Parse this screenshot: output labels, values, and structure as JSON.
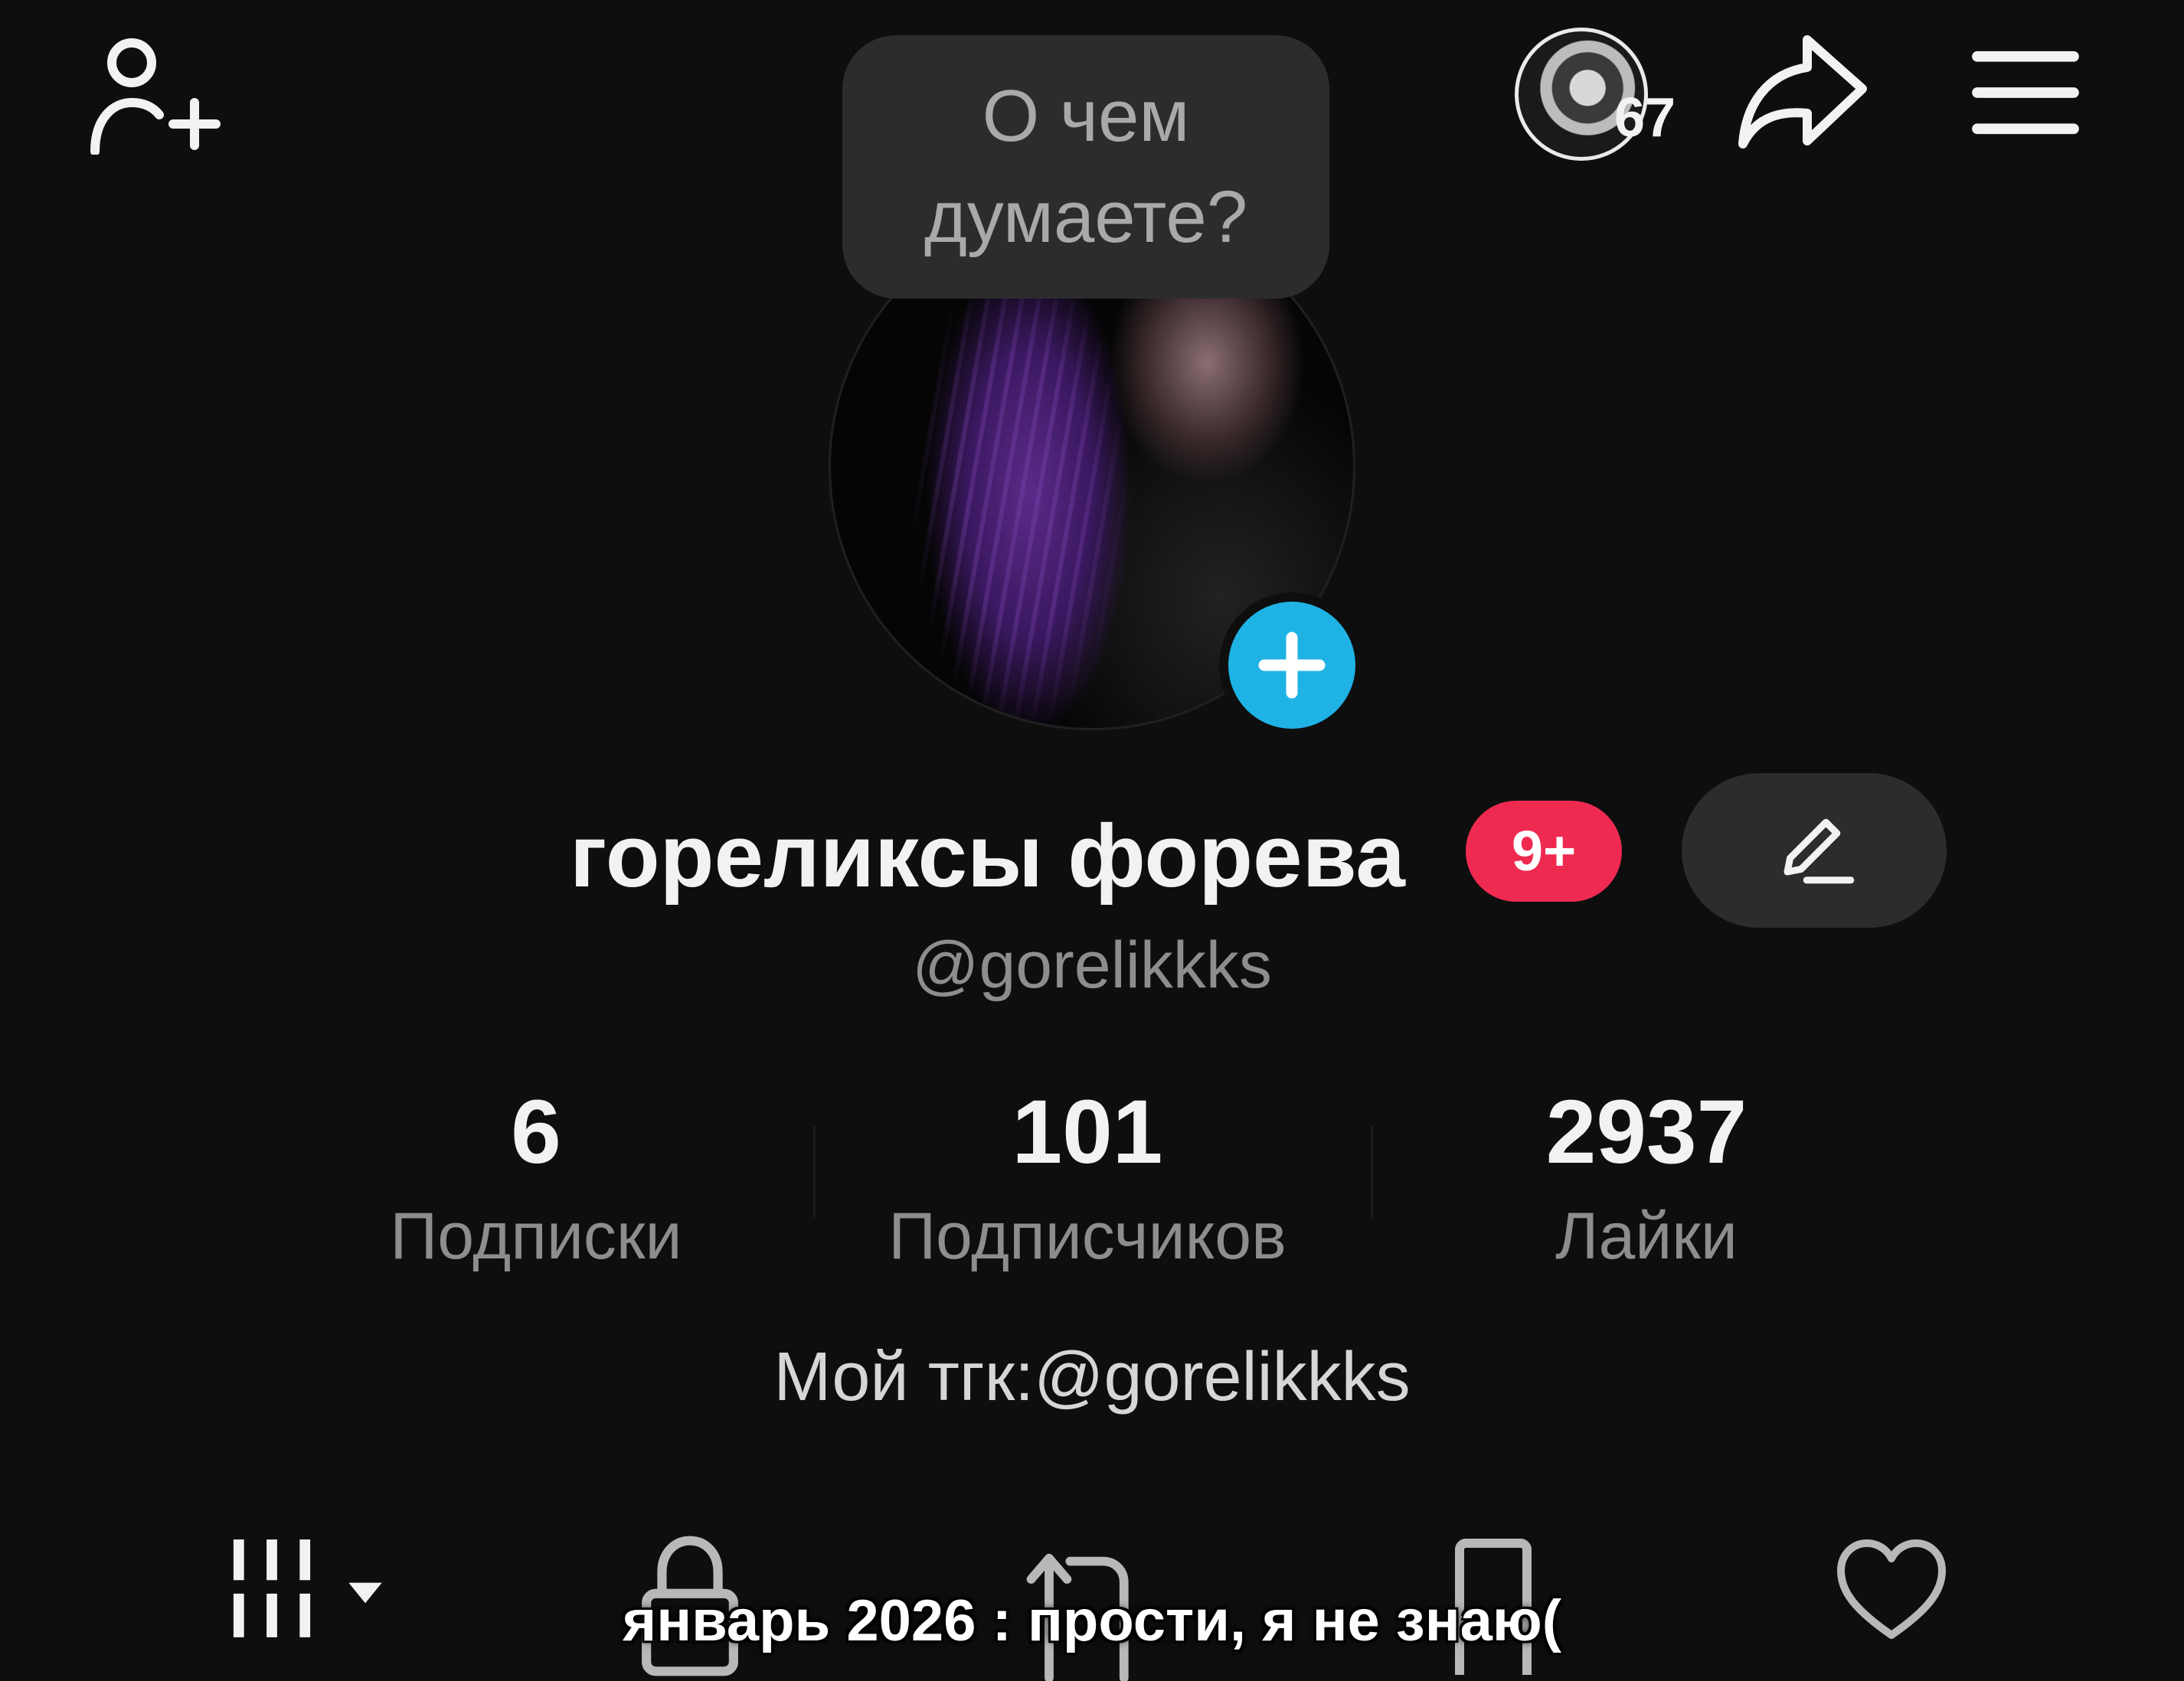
{
  "header": {
    "story_count": "67"
  },
  "thought_bubble": {
    "text": "О чем\nдумаете?"
  },
  "profile": {
    "display_name": "гореликсы форева",
    "notification_badge": "9+",
    "username": "@gorelikkks",
    "bio": "Мой тгк:@gorelikkks"
  },
  "stats": {
    "following": {
      "value": "6",
      "label": "Подписки"
    },
    "followers": {
      "value": "101",
      "label": "Подписчиков"
    },
    "likes": {
      "value": "2937",
      "label": "Лайки"
    }
  },
  "tabs": [
    {
      "icon": "grid-icon"
    },
    {
      "icon": "lock-icon"
    },
    {
      "icon": "repost-icon"
    },
    {
      "icon": "bookmark-icon"
    },
    {
      "icon": "heart-icon"
    }
  ],
  "subtitle": "январь 2026 : прости, я не знаю(",
  "colors": {
    "background": "#0e0e0f",
    "accent_blue": "#1fb3e5",
    "badge_red": "#ef2a51",
    "button_gray": "#2c2c2e"
  }
}
